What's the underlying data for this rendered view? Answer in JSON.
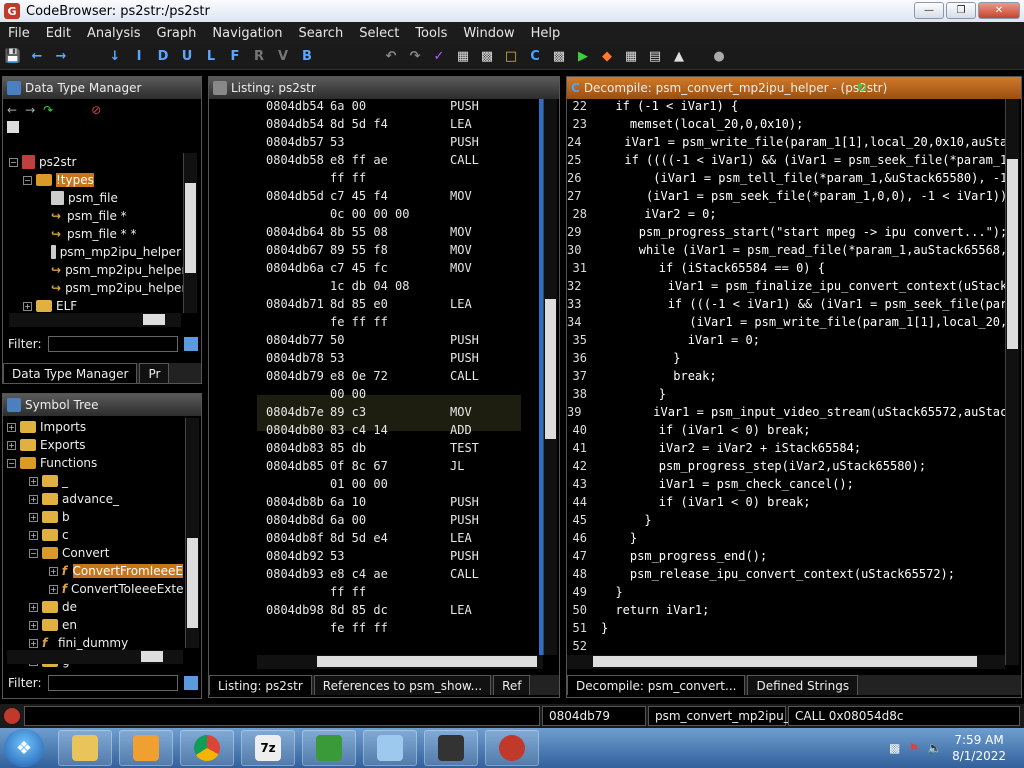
{
  "window": {
    "title": "CodeBrowser: ps2str:/ps2str"
  },
  "menu": [
    "File",
    "Edit",
    "Analysis",
    "Graph",
    "Navigation",
    "Search",
    "Select",
    "Tools",
    "Window",
    "Help"
  ],
  "toolbar_letters": [
    "I",
    "D",
    "U",
    "L",
    "F",
    "R",
    "V",
    "B"
  ],
  "dtm": {
    "title": "Data Type Manager",
    "root": "ps2str",
    "types_folder": "!types",
    "items": [
      "psm_file",
      "psm_file *",
      "psm_file * *",
      "psm_mp2ipu_helper",
      "psm_mp2ipu_helper",
      "psm_mp2ipu_helper"
    ],
    "elf": "ELF",
    "filter_label": "Filter:",
    "tab1": "Data Type Manager",
    "tab2": "Pr"
  },
  "symtree": {
    "title": "Symbol Tree",
    "items": [
      "Imports",
      "Exports",
      "Functions",
      "_",
      "advance_",
      "b",
      "c",
      "Convert",
      "ConvertFromIeeeE",
      "ConvertToIeeeExte",
      "de",
      "en",
      "fini_dummy",
      "g"
    ],
    "filter_label": "Filter:"
  },
  "listing": {
    "title": "Listing:  ps2str",
    "rows": [
      {
        "addr": "0804db54",
        "bytes": "6a 00",
        "mn": "PUSH"
      },
      {
        "addr": "0804db54",
        "bytes": "8d 5d f4",
        "mn": "LEA"
      },
      {
        "addr": "0804db57",
        "bytes": "53",
        "mn": "PUSH"
      },
      {
        "addr": "0804db58",
        "bytes": "e8 ff ae",
        "mn": "CALL"
      },
      {
        "addr": "",
        "bytes": "ff ff",
        "mn": ""
      },
      {
        "addr": "0804db5d",
        "bytes": "c7 45 f4",
        "mn": "MOV"
      },
      {
        "addr": "",
        "bytes": "0c 00 00 00",
        "mn": ""
      },
      {
        "addr": "0804db64",
        "bytes": "8b 55 08",
        "mn": "MOV"
      },
      {
        "addr": "0804db67",
        "bytes": "89 55 f8",
        "mn": "MOV"
      },
      {
        "addr": "0804db6a",
        "bytes": "c7 45 fc",
        "mn": "MOV"
      },
      {
        "addr": "",
        "bytes": "1c db 04 08",
        "mn": ""
      },
      {
        "addr": "0804db71",
        "bytes": "8d 85 e0",
        "mn": "LEA"
      },
      {
        "addr": "",
        "bytes": "fe ff ff",
        "mn": ""
      },
      {
        "addr": "0804db77",
        "bytes": "50",
        "mn": "PUSH"
      },
      {
        "addr": "0804db78",
        "bytes": "53",
        "mn": "PUSH"
      },
      {
        "addr": "0804db79",
        "bytes": "e8 0e 72",
        "mn": "CALL"
      },
      {
        "addr": "",
        "bytes": "00 00",
        "mn": ""
      },
      {
        "addr": "0804db7e",
        "bytes": "89 c3",
        "mn": "MOV"
      },
      {
        "addr": "0804db80",
        "bytes": "83 c4 14",
        "mn": "ADD"
      },
      {
        "addr": "0804db83",
        "bytes": "85 db",
        "mn": "TEST"
      },
      {
        "addr": "0804db85",
        "bytes": "0f 8c 67",
        "mn": "JL"
      },
      {
        "addr": "",
        "bytes": "01 00 00",
        "mn": ""
      },
      {
        "addr": "0804db8b",
        "bytes": "6a 10",
        "mn": "PUSH"
      },
      {
        "addr": "0804db8d",
        "bytes": "6a 00",
        "mn": "PUSH"
      },
      {
        "addr": "0804db8f",
        "bytes": "8d 5d e4",
        "mn": "LEA"
      },
      {
        "addr": "0804db92",
        "bytes": "53",
        "mn": "PUSH"
      },
      {
        "addr": "0804db93",
        "bytes": "e8 c4 ae",
        "mn": "CALL"
      },
      {
        "addr": "",
        "bytes": "ff ff",
        "mn": ""
      },
      {
        "addr": "0804db98",
        "bytes": "8d 85 dc",
        "mn": "LEA"
      },
      {
        "addr": "",
        "bytes": "fe ff ff",
        "mn": ""
      }
    ],
    "tabs": [
      "Listing:  ps2str",
      "References to psm_show...",
      "Ref"
    ]
  },
  "decompile": {
    "title": "Decompile: psm_convert_mp2ipu_helper - (ps2str)",
    "lines": [
      {
        "n": "22",
        "t": "  if (-1 < iVar1) {"
      },
      {
        "n": "23",
        "t": "    memset(local_20,0,0x10);"
      },
      {
        "n": "24",
        "t": "    iVar1 = psm_write_file(param_1[1],local_20,0x10,auStack"
      },
      {
        "n": "25",
        "t": "    if ((((-1 < iVar1) && (iVar1 = psm_seek_file(*param_1,0"
      },
      {
        "n": "26",
        "t": "        (iVar1 = psm_tell_file(*param_1,&uStack65580), -1 <"
      },
      {
        "n": "27",
        "t": "       (iVar1 = psm_seek_file(*param_1,0,0), -1 < iVar1)) "
      },
      {
        "n": "28",
        "t": "      iVar2 = 0;"
      },
      {
        "n": "29",
        "t": "      psm_progress_start(\"start mpeg -> ipu convert...\");"
      },
      {
        "n": "30",
        "t": "      while (iVar1 = psm_read_file(*param_1,auStack65568,0x"
      },
      {
        "n": "31",
        "t": "        if (iStack65584 == 0) {"
      },
      {
        "n": "32",
        "t": "          iVar1 = psm_finalize_ipu_convert_context(uStack6"
      },
      {
        "n": "33",
        "t": "          if (((-1 < iVar1) && (iVar1 = psm_seek_file(param"
      },
      {
        "n": "34",
        "t": "             (iVar1 = psm_write_file(param_1[1],local_20,0x"
      },
      {
        "n": "35",
        "t": "            iVar1 = 0;"
      },
      {
        "n": "36",
        "t": "          }"
      },
      {
        "n": "37",
        "t": "          break;"
      },
      {
        "n": "38",
        "t": "        }"
      },
      {
        "n": "39",
        "t": "        iVar1 = psm_input_video_stream(uStack65572,auStack6"
      },
      {
        "n": "40",
        "t": "        if (iVar1 < 0) break;"
      },
      {
        "n": "41",
        "t": "        iVar2 = iVar2 + iStack65584;"
      },
      {
        "n": "42",
        "t": "        psm_progress_step(iVar2,uStack65580);"
      },
      {
        "n": "43",
        "t": "        iVar1 = psm_check_cancel();"
      },
      {
        "n": "44",
        "t": "        if (iVar1 < 0) break;"
      },
      {
        "n": "45",
        "t": "      }"
      },
      {
        "n": "46",
        "t": "    }"
      },
      {
        "n": "47",
        "t": "    psm_progress_end();"
      },
      {
        "n": "48",
        "t": "    psm_release_ipu_convert_context(uStack65572);"
      },
      {
        "n": "49",
        "t": "  }"
      },
      {
        "n": "50",
        "t": "  return iVar1;"
      },
      {
        "n": "51",
        "t": "}"
      },
      {
        "n": "52",
        "t": ""
      }
    ],
    "tabs": [
      "Decompile: psm_convert...",
      "Defined Strings"
    ]
  },
  "status": {
    "addr": "0804db79",
    "func": "psm_convert_mp2ipu_h...",
    "instr": "CALL 0x08054d8c"
  },
  "taskbar": {
    "time": "7:59 AM",
    "date": "8/1/2022"
  },
  "colors": {
    "accent": "#c8751a",
    "menubar": "#1c1c1c",
    "code_fn": "#66aaff"
  }
}
